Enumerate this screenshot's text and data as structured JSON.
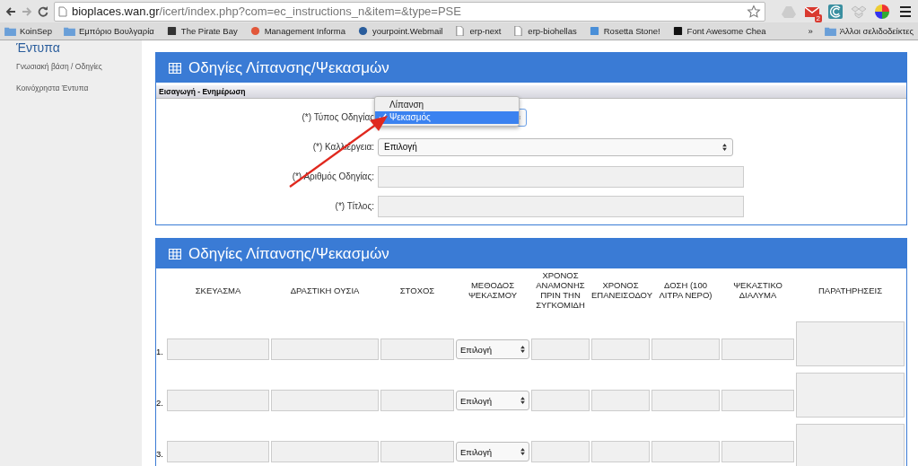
{
  "browser": {
    "url_host": "bioplaces.wan.gr",
    "url_path": "/icert/index.php?com=ec_instructions_n&item=&type=PSE",
    "mail_badge": "2",
    "bookmarks": [
      {
        "label": "KoinSep",
        "kind": "folder"
      },
      {
        "label": "Εμπόριο Βουλγαρία",
        "kind": "folder"
      },
      {
        "label": "The Pirate Bay",
        "kind": "ship"
      },
      {
        "label": "Management Informa",
        "kind": "apple"
      },
      {
        "label": "yourpoint.Webmail",
        "kind": "globe"
      },
      {
        "label": "erp-next",
        "kind": "page"
      },
      {
        "label": "erp-biohellas",
        "kind": "page"
      },
      {
        "label": "Rosetta Stone!",
        "kind": "stone"
      },
      {
        "label": "Font Awesome Chea",
        "kind": "flag"
      }
    ],
    "overflow": "»",
    "other_bookmarks": "Άλλοι σελιδοδείκτες"
  },
  "sidebar": {
    "heading": "Έντυπα",
    "items": [
      "Γνωσιακή βάση / Οδηγίες",
      "Κοινόχρηστα Έντυπα"
    ]
  },
  "form_panel": {
    "title": "Οδηγίες Λίπανσης/Ψεκασμών",
    "section": "Εισαγωγή - Ενημέρωση",
    "fields": [
      {
        "label": "(*) Τύπος Οδηγίας",
        "kind": "select",
        "options": [
          {
            "label": "Λίπανση",
            "selected": false
          },
          {
            "label": "Ψεκασμός",
            "selected": true
          }
        ]
      },
      {
        "label": "(*) Καλλιέργεια:",
        "kind": "select",
        "value": "Επιλογή"
      },
      {
        "label": "(*) Αριθμός Οδηγίας:",
        "kind": "text"
      },
      {
        "label": "(*) Τίτλος:",
        "kind": "text"
      }
    ]
  },
  "table_panel": {
    "title": "Οδηγίες Λίπανσης/Ψεκασμών",
    "columns": [
      "ΣΚΕΥΑΣΜΑ",
      "ΔΡΑΣΤΙΚΗ ΟΥΣΙΑ",
      "ΣΤΟΧΟΣ",
      "ΜΕΘΟΔΟΣ ΨΕΚΑΣΜΟΥ",
      "ΧΡΟΝΟΣ ΑΝΑΜΟΝΗΣ ΠΡΙΝ ΤΗΝ ΣΥΓΚΟΜΙΔΗ",
      "ΧΡΟΝΟΣ ΕΠΑΝΕΙΣΟΔΟΥ",
      "ΔΟΣΗ (100 ΛΙΤΡΑ ΝΕΡΟ)",
      "ΨΕΚΑΣΤΙΚΟ ΔΙΑΛΥΜΑ",
      "ΠΑΡΑΤΗΡΗΣΕΙΣ"
    ],
    "rows": [
      {
        "number": "1.",
        "method": "Επιλογή"
      },
      {
        "number": "2.",
        "method": "Επιλογή"
      },
      {
        "number": "3.",
        "method": "Επιλογή"
      }
    ]
  }
}
